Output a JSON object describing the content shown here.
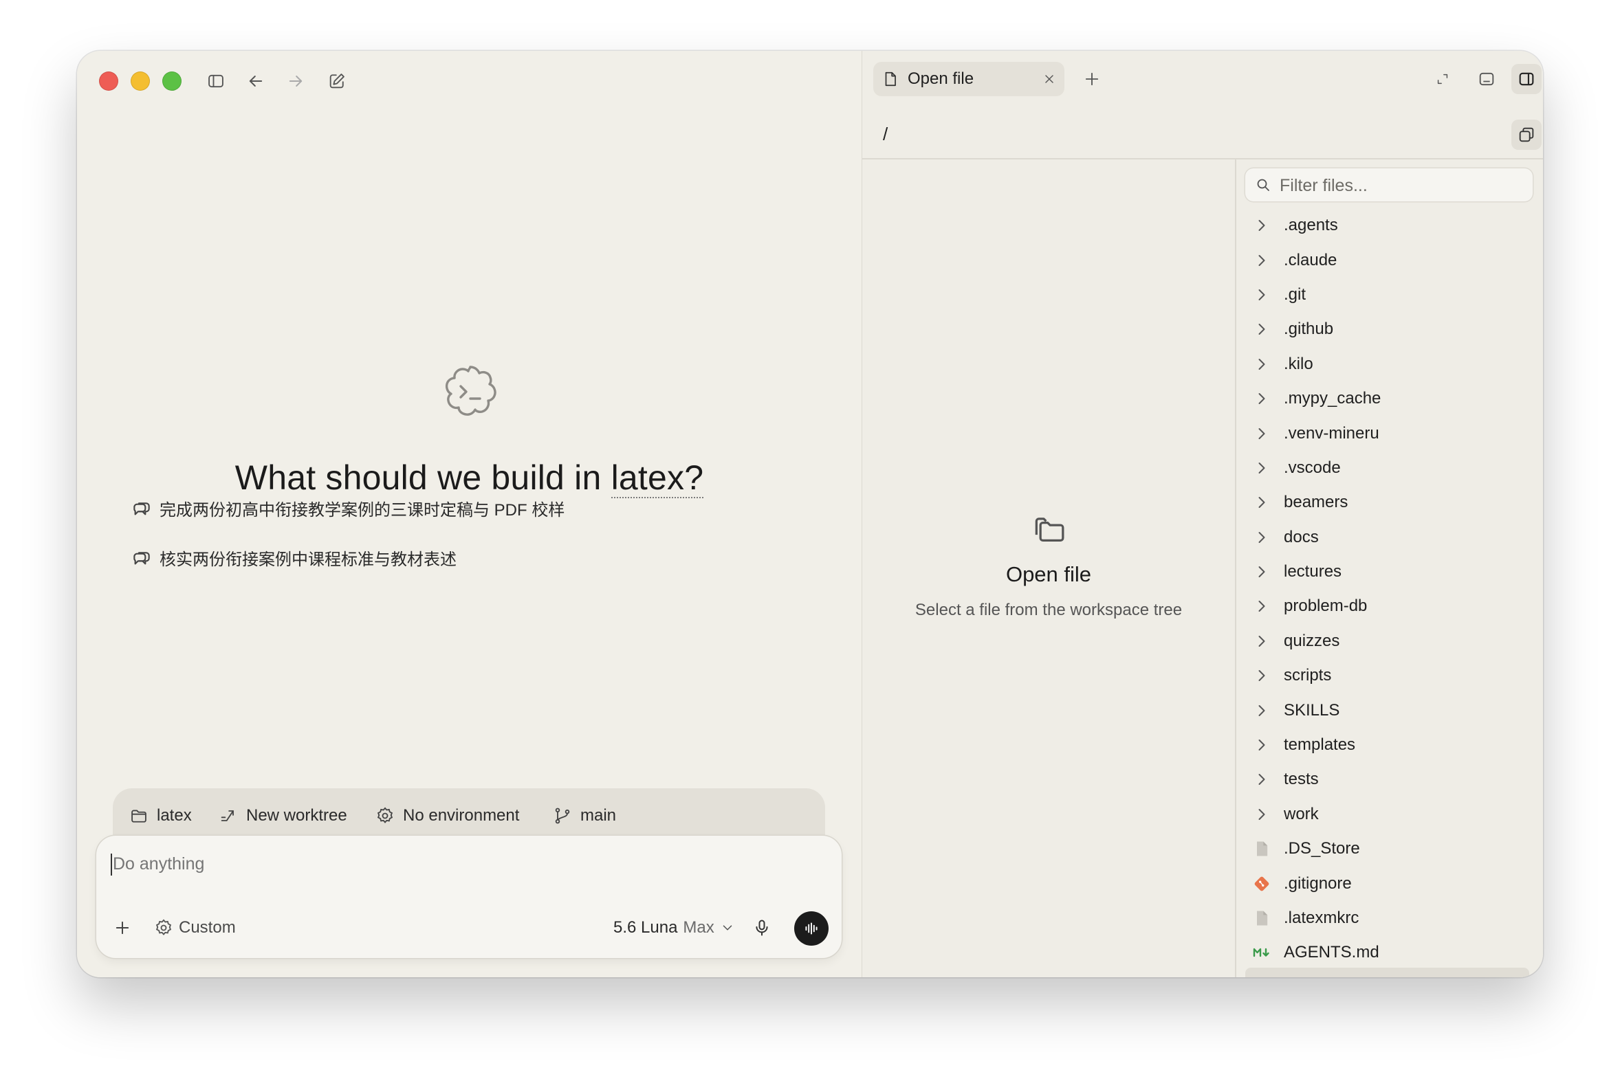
{
  "colors": {
    "traffic_red": "#ee5d55",
    "traffic_yellow": "#f4be30",
    "traffic_green": "#5cc145",
    "git_orange": "#e8744a",
    "markdown_green": "#3a9a4a",
    "send_button": "#1c1c1c"
  },
  "hero": {
    "title_prefix": "What should we build in ",
    "title_project": "latex?"
  },
  "suggestions": [
    {
      "text": "完成两份初高中衔接教学案例的三课时定稿与 PDF 校样"
    },
    {
      "text": "核实两份衔接案例中课程标准与教材表述"
    }
  ],
  "context_bar": {
    "project": "latex",
    "worktree": "New worktree",
    "environment": "No environment",
    "branch": "main"
  },
  "composer": {
    "placeholder": "Do anything",
    "mode": "Custom",
    "model": "5.6 Luna",
    "model_variant": "Max"
  },
  "right_pane": {
    "tab_label": "Open file",
    "path": "/",
    "empty_title": "Open file",
    "empty_subtitle": "Select a file from the workspace tree"
  },
  "file_tree": {
    "filter_placeholder": "Filter files...",
    "items": [
      {
        "name": ".agents",
        "kind": "folder"
      },
      {
        "name": ".claude",
        "kind": "folder"
      },
      {
        "name": ".git",
        "kind": "folder"
      },
      {
        "name": ".github",
        "kind": "folder"
      },
      {
        "name": ".kilo",
        "kind": "folder"
      },
      {
        "name": ".mypy_cache",
        "kind": "folder"
      },
      {
        "name": ".venv-mineru",
        "kind": "folder"
      },
      {
        "name": ".vscode",
        "kind": "folder"
      },
      {
        "name": "beamers",
        "kind": "folder"
      },
      {
        "name": "docs",
        "kind": "folder"
      },
      {
        "name": "lectures",
        "kind": "folder"
      },
      {
        "name": "problem-db",
        "kind": "folder"
      },
      {
        "name": "quizzes",
        "kind": "folder"
      },
      {
        "name": "scripts",
        "kind": "folder"
      },
      {
        "name": "SKILLS",
        "kind": "folder"
      },
      {
        "name": "templates",
        "kind": "folder"
      },
      {
        "name": "tests",
        "kind": "folder"
      },
      {
        "name": "work",
        "kind": "folder"
      },
      {
        "name": ".DS_Store",
        "kind": "file",
        "icon": "file-icon"
      },
      {
        "name": ".gitignore",
        "kind": "file",
        "icon": "git-icon"
      },
      {
        "name": ".latexmkrc",
        "kind": "file",
        "icon": "file-icon"
      },
      {
        "name": "AGENTS.md",
        "kind": "file",
        "icon": "markdown-icon"
      }
    ]
  }
}
